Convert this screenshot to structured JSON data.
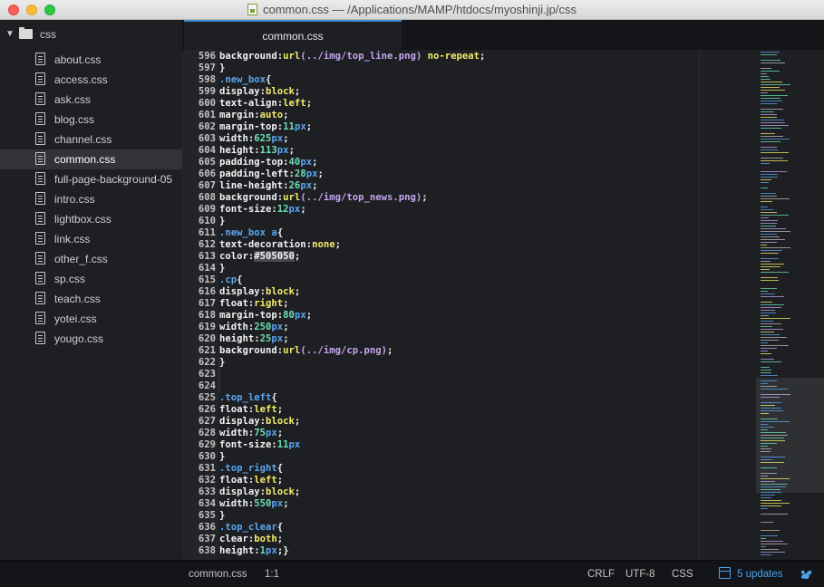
{
  "window": {
    "title": "common.css — /Applications/MAMP/htdocs/myoshinji.jp/css"
  },
  "sidebar": {
    "folder": "css",
    "files": [
      {
        "label": "about.css",
        "selected": false
      },
      {
        "label": "access.css",
        "selected": false
      },
      {
        "label": "ask.css",
        "selected": false
      },
      {
        "label": "blog.css",
        "selected": false
      },
      {
        "label": "channel.css",
        "selected": false
      },
      {
        "label": "common.css",
        "selected": true
      },
      {
        "label": "full-page-background-05",
        "selected": false
      },
      {
        "label": "intro.css",
        "selected": false
      },
      {
        "label": "lightbox.css",
        "selected": false
      },
      {
        "label": "link.css",
        "selected": false
      },
      {
        "label": "other_f.css",
        "selected": false
      },
      {
        "label": "sp.css",
        "selected": false
      },
      {
        "label": "teach.css",
        "selected": false
      },
      {
        "label": "yotei.css",
        "selected": false
      },
      {
        "label": "yougo.css",
        "selected": false
      }
    ]
  },
  "tabs": [
    {
      "label": "common.css",
      "active": true
    }
  ],
  "editor": {
    "lines": [
      {
        "n": "596",
        "tokens": [
          [
            "background:",
            "prop"
          ],
          [
            "url",
            "fn"
          ],
          [
            "(../img/top_line.png)",
            "url"
          ],
          [
            " ",
            "prop"
          ],
          [
            "no-repeat",
            "kw"
          ],
          [
            ";",
            "prop"
          ]
        ]
      },
      {
        "n": "597",
        "tokens": [
          [
            "}",
            "prop"
          ]
        ]
      },
      {
        "n": "598",
        "tokens": [
          [
            ".new_box",
            "sel"
          ],
          [
            "{",
            "prop"
          ]
        ]
      },
      {
        "n": "599",
        "tokens": [
          [
            "display:",
            "prop"
          ],
          [
            "block",
            "kw"
          ],
          [
            ";",
            "prop"
          ]
        ]
      },
      {
        "n": "600",
        "tokens": [
          [
            "text-align:",
            "prop"
          ],
          [
            "left",
            "kw"
          ],
          [
            ";",
            "prop"
          ]
        ]
      },
      {
        "n": "601",
        "tokens": [
          [
            "margin:",
            "prop"
          ],
          [
            "auto",
            "kw"
          ],
          [
            ";",
            "prop"
          ]
        ]
      },
      {
        "n": "602",
        "tokens": [
          [
            "margin-top:",
            "prop"
          ],
          [
            "11",
            "num"
          ],
          [
            "px",
            "px"
          ],
          [
            ";",
            "prop"
          ]
        ]
      },
      {
        "n": "603",
        "tokens": [
          [
            "width:",
            "prop"
          ],
          [
            "625",
            "num"
          ],
          [
            "px",
            "px"
          ],
          [
            ";",
            "prop"
          ]
        ]
      },
      {
        "n": "604",
        "tokens": [
          [
            "height:",
            "prop"
          ],
          [
            "113",
            "num"
          ],
          [
            "px",
            "px"
          ],
          [
            ";",
            "prop"
          ]
        ]
      },
      {
        "n": "605",
        "tokens": [
          [
            "padding-top:",
            "prop"
          ],
          [
            "40",
            "num"
          ],
          [
            "px",
            "px"
          ],
          [
            ";",
            "prop"
          ]
        ]
      },
      {
        "n": "606",
        "tokens": [
          [
            "padding-left:",
            "prop"
          ],
          [
            "28",
            "num"
          ],
          [
            "px",
            "px"
          ],
          [
            ";",
            "prop"
          ]
        ]
      },
      {
        "n": "607",
        "tokens": [
          [
            "line-height:",
            "prop"
          ],
          [
            "26",
            "num"
          ],
          [
            "px",
            "px"
          ],
          [
            ";",
            "prop"
          ]
        ]
      },
      {
        "n": "608",
        "tokens": [
          [
            "background:",
            "prop"
          ],
          [
            "url",
            "fn"
          ],
          [
            "(../img/top_news.png)",
            "url"
          ],
          [
            ";",
            "prop"
          ]
        ]
      },
      {
        "n": "609",
        "tokens": [
          [
            "font-size:",
            "prop"
          ],
          [
            "12",
            "num"
          ],
          [
            "px",
            "px"
          ],
          [
            ";",
            "prop"
          ]
        ]
      },
      {
        "n": "610",
        "tokens": [
          [
            "}",
            "prop"
          ]
        ]
      },
      {
        "n": "611",
        "tokens": [
          [
            ".new_box",
            "sel"
          ],
          [
            " ",
            "prop"
          ],
          [
            "a",
            "sel"
          ],
          [
            "{",
            "prop"
          ]
        ]
      },
      {
        "n": "612",
        "tokens": [
          [
            "text-decoration:",
            "prop"
          ],
          [
            "none",
            "kw"
          ],
          [
            ";",
            "prop"
          ]
        ]
      },
      {
        "n": "613",
        "tokens": [
          [
            "color:",
            "prop"
          ],
          [
            "#505050",
            "hex"
          ],
          [
            ";",
            "prop"
          ]
        ]
      },
      {
        "n": "614",
        "tokens": [
          [
            "}",
            "prop"
          ]
        ]
      },
      {
        "n": "615",
        "tokens": [
          [
            ".cp",
            "sel"
          ],
          [
            "{",
            "prop"
          ]
        ]
      },
      {
        "n": "616",
        "tokens": [
          [
            "display:",
            "prop"
          ],
          [
            "block",
            "kw"
          ],
          [
            ";",
            "prop"
          ]
        ]
      },
      {
        "n": "617",
        "tokens": [
          [
            "float:",
            "prop"
          ],
          [
            "right",
            "kw"
          ],
          [
            ";",
            "prop"
          ]
        ]
      },
      {
        "n": "618",
        "tokens": [
          [
            "margin-top:",
            "prop"
          ],
          [
            "80",
            "num"
          ],
          [
            "px",
            "px"
          ],
          [
            ";",
            "prop"
          ]
        ]
      },
      {
        "n": "619",
        "tokens": [
          [
            "width:",
            "prop"
          ],
          [
            "250",
            "num"
          ],
          [
            "px",
            "px"
          ],
          [
            ";",
            "prop"
          ]
        ]
      },
      {
        "n": "620",
        "tokens": [
          [
            "height:",
            "prop"
          ],
          [
            "25",
            "num"
          ],
          [
            "px",
            "px"
          ],
          [
            ";",
            "prop"
          ]
        ]
      },
      {
        "n": "621",
        "tokens": [
          [
            "background:",
            "prop"
          ],
          [
            "url",
            "fn"
          ],
          [
            "(../img/cp.png)",
            "url"
          ],
          [
            ";",
            "prop"
          ]
        ]
      },
      {
        "n": "622",
        "tokens": [
          [
            "}",
            "prop"
          ]
        ]
      },
      {
        "n": "623",
        "tokens": []
      },
      {
        "n": "624",
        "tokens": []
      },
      {
        "n": "625",
        "tokens": [
          [
            ".top_left",
            "sel"
          ],
          [
            "{",
            "prop"
          ]
        ]
      },
      {
        "n": "626",
        "tokens": [
          [
            "float:",
            "prop"
          ],
          [
            "left",
            "kw"
          ],
          [
            ";",
            "prop"
          ]
        ]
      },
      {
        "n": "627",
        "tokens": [
          [
            "display:",
            "prop"
          ],
          [
            "block",
            "kw"
          ],
          [
            ";",
            "prop"
          ]
        ]
      },
      {
        "n": "628",
        "tokens": [
          [
            "width:",
            "prop"
          ],
          [
            "75",
            "num"
          ],
          [
            "px",
            "px"
          ],
          [
            ";",
            "prop"
          ]
        ]
      },
      {
        "n": "629",
        "tokens": [
          [
            "font-size:",
            "prop"
          ],
          [
            "11",
            "num"
          ],
          [
            "px",
            "px"
          ]
        ]
      },
      {
        "n": "630",
        "tokens": [
          [
            "}",
            "prop"
          ]
        ]
      },
      {
        "n": "631",
        "tokens": [
          [
            ".top_right",
            "sel"
          ],
          [
            "{",
            "prop"
          ]
        ]
      },
      {
        "n": "632",
        "tokens": [
          [
            "float:",
            "prop"
          ],
          [
            "left",
            "kw"
          ],
          [
            ";",
            "prop"
          ]
        ]
      },
      {
        "n": "633",
        "tokens": [
          [
            "display:",
            "prop"
          ],
          [
            "block",
            "kw"
          ],
          [
            ";",
            "prop"
          ]
        ]
      },
      {
        "n": "634",
        "tokens": [
          [
            "width:",
            "prop"
          ],
          [
            "550",
            "num"
          ],
          [
            "px",
            "px"
          ],
          [
            ";",
            "prop"
          ]
        ]
      },
      {
        "n": "635",
        "tokens": [
          [
            "}",
            "prop"
          ]
        ]
      },
      {
        "n": "636",
        "tokens": [
          [
            ".top_clear",
            "sel"
          ],
          [
            "{",
            "prop"
          ]
        ]
      },
      {
        "n": "637",
        "tokens": [
          [
            "clear:",
            "prop"
          ],
          [
            "both",
            "kw"
          ],
          [
            ";",
            "prop"
          ]
        ]
      },
      {
        "n": "638",
        "tokens": [
          [
            "height:",
            "prop"
          ],
          [
            "1",
            "num"
          ],
          [
            "px",
            "px"
          ],
          [
            ";}",
            "prop"
          ]
        ]
      }
    ]
  },
  "statusbar": {
    "file": "common.css",
    "position": "1:1",
    "line_ending": "CRLF",
    "encoding": "UTF-8",
    "grammar": "CSS",
    "updates": "5 updates"
  },
  "colors": {
    "accent": "#3a8bd1",
    "selector": "#58a6f0",
    "keyword": "#f2ec68",
    "number": "#6ce0b4",
    "url": "#c3a6ec",
    "text": "#f1f1f1"
  }
}
